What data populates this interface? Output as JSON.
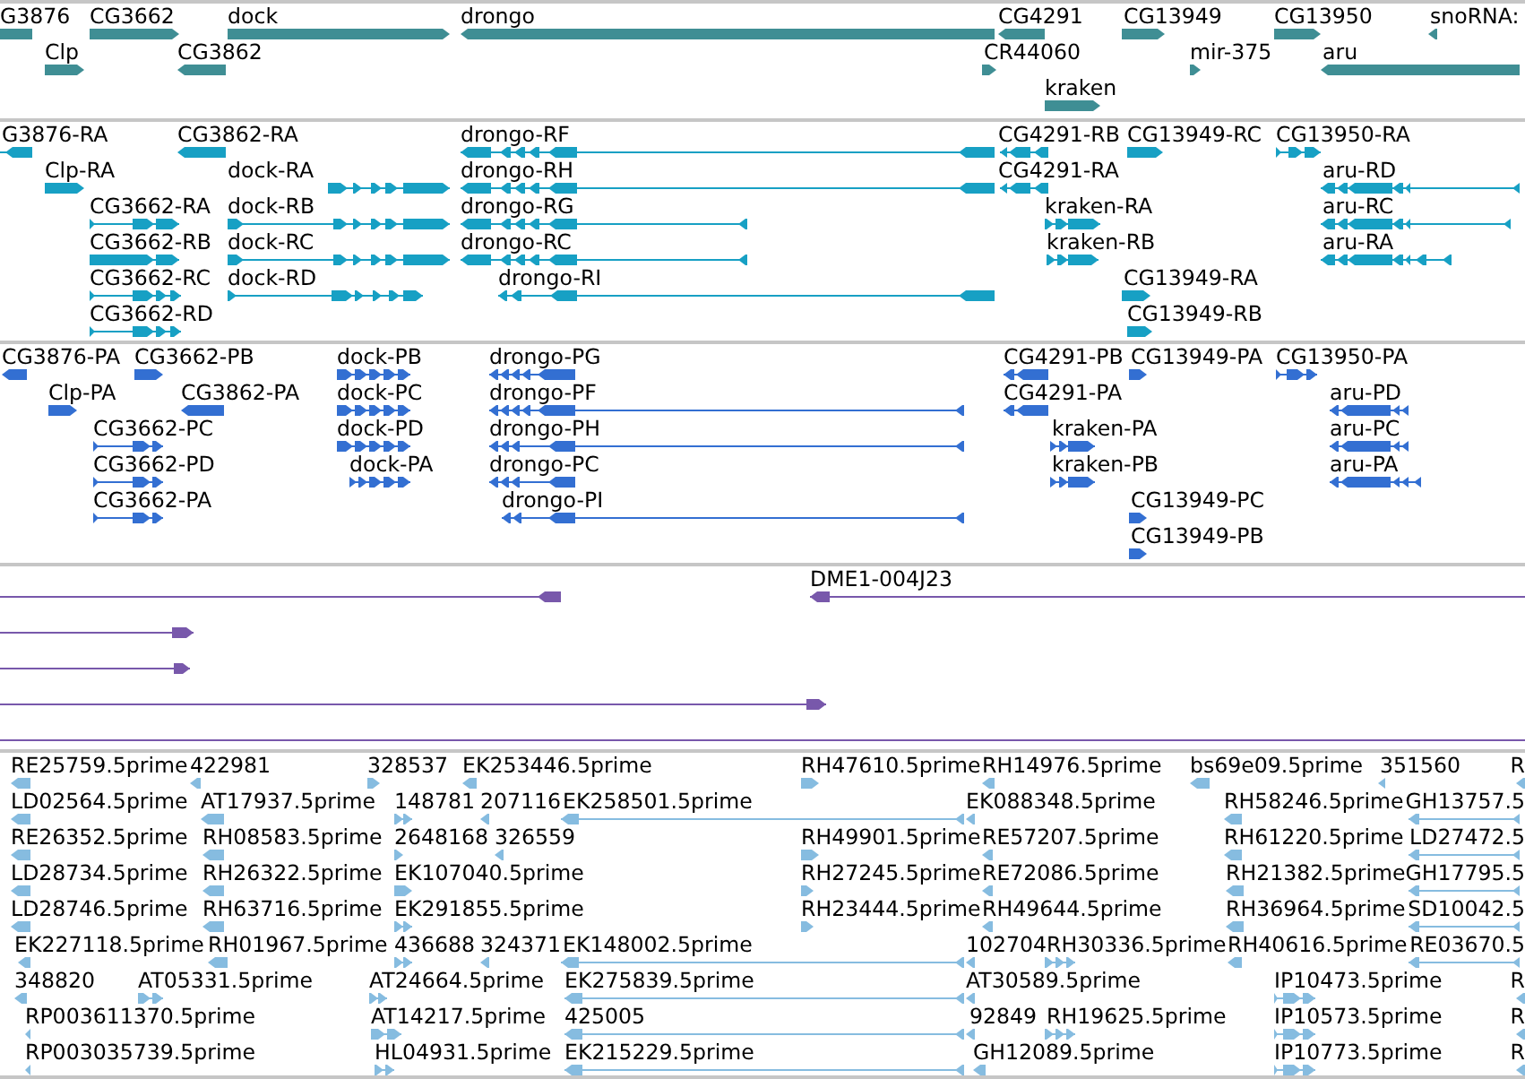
{
  "tracks": [
    {
      "color": "#3f8e94",
      "rows": [
        {
          "features": [
            {
              "label": "G3876"
            },
            {
              "label": "CG3662",
              "reverse": false
            },
            {
              "label": "dock",
              "reverse": false
            },
            {
              "label": "drongo",
              "reverse": true
            },
            {
              "label": "CG4291",
              "reverse": true
            },
            {
              "label": "CG13949",
              "reverse": false
            },
            {
              "label": "CG13950",
              "reverse": false
            },
            {
              "label": "snoRNA:",
              "reverse": true
            }
          ]
        },
        {
          "features": [
            {
              "label": "Clp",
              "reverse": false
            },
            {
              "label": "CG3862",
              "reverse": true
            },
            {
              "label": "CR44060",
              "reverse": false
            },
            {
              "label": "mir-375",
              "reverse": false
            },
            {
              "label": "aru",
              "reverse": true
            }
          ]
        },
        {
          "features": [
            {
              "label": "kraken",
              "reverse": false
            }
          ]
        }
      ]
    },
    {
      "color": "#17a0c4",
      "rows": [
        {
          "features": [
            {
              "label": "G3876-RA",
              "reverse": true
            },
            {
              "label": "CG3862-RA",
              "reverse": true
            },
            {
              "label": "drongo-RF",
              "reverse": true
            },
            {
              "label": "CG4291-RB",
              "reverse": true
            },
            {
              "label": "CG13949-RC",
              "reverse": false
            },
            {
              "label": "CG13950-RA",
              "reverse": false
            }
          ]
        },
        {
          "features": [
            {
              "label": "Clp-RA",
              "reverse": false
            },
            {
              "label": "dock-RA",
              "reverse": false
            },
            {
              "label": "drongo-RH",
              "reverse": true
            },
            {
              "label": "CG4291-RA",
              "reverse": true
            },
            {
              "label": "aru-RD",
              "reverse": true
            }
          ]
        },
        {
          "features": [
            {
              "label": "CG3662-RA",
              "reverse": false
            },
            {
              "label": "dock-RB",
              "reverse": false
            },
            {
              "label": "drongo-RG",
              "reverse": true
            },
            {
              "label": "kraken-RA",
              "reverse": false
            },
            {
              "label": "aru-RC",
              "reverse": true
            }
          ]
        },
        {
          "features": [
            {
              "label": "CG3662-RB",
              "reverse": false
            },
            {
              "label": "dock-RC",
              "reverse": false
            },
            {
              "label": "drongo-RC",
              "reverse": true
            },
            {
              "label": "kraken-RB",
              "reverse": false
            },
            {
              "label": "aru-RA",
              "reverse": true
            }
          ]
        },
        {
          "features": [
            {
              "label": "CG3662-RC",
              "reverse": false
            },
            {
              "label": "dock-RD",
              "reverse": false
            },
            {
              "label": "drongo-RI",
              "reverse": true
            },
            {
              "label": "CG13949-RA",
              "reverse": false
            }
          ]
        },
        {
          "features": [
            {
              "label": "CG3662-RD",
              "reverse": false
            },
            {
              "label": "CG13949-RB",
              "reverse": false
            }
          ]
        }
      ]
    },
    {
      "color": "#336fd2",
      "rows": [
        {
          "features": [
            {
              "label": "CG3876-PA",
              "reverse": true
            },
            {
              "label": "CG3662-PB",
              "reverse": false
            },
            {
              "label": "dock-PB",
              "reverse": false
            },
            {
              "label": "drongo-PG",
              "reverse": true
            },
            {
              "label": "CG4291-PB",
              "reverse": true
            },
            {
              "label": "CG13949-PA",
              "reverse": false
            },
            {
              "label": "CG13950-PA",
              "reverse": false
            }
          ]
        },
        {
          "features": [
            {
              "label": "Clp-PA",
              "reverse": false
            },
            {
              "label": "CG3862-PA",
              "reverse": true
            },
            {
              "label": "dock-PC",
              "reverse": false
            },
            {
              "label": "drongo-PF",
              "reverse": true
            },
            {
              "label": "CG4291-PA",
              "reverse": true
            },
            {
              "label": "aru-PD",
              "reverse": true
            }
          ]
        },
        {
          "features": [
            {
              "label": "CG3662-PC",
              "reverse": false
            },
            {
              "label": "dock-PD",
              "reverse": false
            },
            {
              "label": "drongo-PH",
              "reverse": true
            },
            {
              "label": "kraken-PA",
              "reverse": false
            },
            {
              "label": "aru-PC",
              "reverse": true
            }
          ]
        },
        {
          "features": [
            {
              "label": "CG3662-PD",
              "reverse": false
            },
            {
              "label": "dock-PA",
              "reverse": false
            },
            {
              "label": "drongo-PC",
              "reverse": true
            },
            {
              "label": "kraken-PB",
              "reverse": false
            },
            {
              "label": "aru-PA",
              "reverse": true
            }
          ]
        },
        {
          "features": [
            {
              "label": "CG3662-PA",
              "reverse": false
            },
            {
              "label": "drongo-PI",
              "reverse": true
            },
            {
              "label": "CG13949-PC",
              "reverse": false
            }
          ]
        },
        {
          "features": [
            {
              "label": "CG13949-PB",
              "reverse": false
            }
          ]
        }
      ]
    },
    {
      "color": "#7858ab",
      "rows": [
        {
          "features": [
            {
              "kind": "arrow",
              "reverse": true
            },
            {
              "kind": "arrow",
              "label": "DME1-004J23",
              "reverse": true
            }
          ]
        },
        {
          "features": [
            {
              "kind": "arrow",
              "reverse": false
            }
          ]
        },
        {
          "features": [
            {
              "kind": "arrow",
              "reverse": false
            }
          ]
        },
        {
          "features": [
            {
              "kind": "arrow",
              "reverse": false
            }
          ]
        },
        {
          "features": [
            {
              "kind": "line"
            }
          ]
        }
      ]
    },
    {
      "color": "#86bce0",
      "rows": [
        {
          "features": [
            {
              "label": "RE25759.5prime",
              "reverse": true
            },
            {
              "label": "422981",
              "reverse": true
            },
            {
              "label": "328537",
              "reverse": false
            },
            {
              "label": "EK253446.5prime",
              "reverse": true
            },
            {
              "label": "RH47610.5prime",
              "reverse": false
            },
            {
              "label": "RH14976.5prime",
              "reverse": true
            },
            {
              "label": "bs69e09.5prime",
              "reverse": true
            },
            {
              "label": "351560",
              "reverse": true
            },
            {
              "label": "R",
              "reverse": true
            }
          ]
        },
        {
          "features": [
            {
              "label": "LD02564.5prime",
              "reverse": true
            },
            {
              "label": "AT17937.5prime",
              "reverse": true
            },
            {
              "label": "148781",
              "reverse": false
            },
            {
              "label": "207116",
              "reverse": true
            },
            {
              "label": "EK258501.5prime",
              "reverse": true
            },
            {
              "label": "EK088348.5prime",
              "reverse": true
            },
            {
              "label": "RH58246.5prime",
              "reverse": true
            },
            {
              "label": "GH13757.5",
              "reverse": true
            }
          ]
        },
        {
          "features": [
            {
              "label": "RE26352.5prime",
              "reverse": true
            },
            {
              "label": "RH08583.5prime",
              "reverse": true
            },
            {
              "label": "2648168",
              "reverse": false
            },
            {
              "label": "326559",
              "reverse": true
            },
            {
              "label": "RH49901.5prime",
              "reverse": false
            },
            {
              "label": "RE57207.5prime",
              "reverse": true
            },
            {
              "label": "RH61220.5prime",
              "reverse": true
            },
            {
              "label": "LD27472.5",
              "reverse": true
            }
          ]
        },
        {
          "features": [
            {
              "label": "LD28734.5prime",
              "reverse": true
            },
            {
              "label": "RH26322.5prime",
              "reverse": true
            },
            {
              "label": "EK107040.5prime",
              "reverse": false
            },
            {
              "label": "RH27245.5prime",
              "reverse": false
            },
            {
              "label": "RE72086.5prime",
              "reverse": true
            },
            {
              "label": "RH21382.5prime",
              "reverse": true
            },
            {
              "label": "GH17795.5",
              "reverse": true
            }
          ]
        },
        {
          "features": [
            {
              "label": "LD28746.5prime",
              "reverse": true
            },
            {
              "label": "RH63716.5prime",
              "reverse": true
            },
            {
              "label": "EK291855.5prime",
              "reverse": false
            },
            {
              "label": "RH23444.5prime",
              "reverse": false
            },
            {
              "label": "RH49644.5prime",
              "reverse": true
            },
            {
              "label": "RH36964.5prime",
              "reverse": true
            },
            {
              "label": "SD10042.5",
              "reverse": true
            }
          ]
        },
        {
          "features": [
            {
              "label": "EK227118.5prime",
              "reverse": true
            },
            {
              "label": "RH01967.5prime",
              "reverse": true
            },
            {
              "label": "436688",
              "reverse": false
            },
            {
              "label": "324371",
              "reverse": true
            },
            {
              "label": "EK148002.5prime",
              "reverse": true
            },
            {
              "label": "102704",
              "reverse": true
            },
            {
              "label": "RH30336.5prime",
              "reverse": false
            },
            {
              "label": "RH40616.5prime",
              "reverse": true
            },
            {
              "label": "RE03670.5",
              "reverse": true
            }
          ]
        },
        {
          "features": [
            {
              "label": "348820",
              "reverse": true
            },
            {
              "label": "AT05331.5prime",
              "reverse": false
            },
            {
              "label": "AT24664.5prime",
              "reverse": false
            },
            {
              "label": "EK275839.5prime",
              "reverse": true
            },
            {
              "label": "AT30589.5prime",
              "reverse": true
            },
            {
              "label": "IP10473.5prime",
              "reverse": false
            },
            {
              "label": "R",
              "reverse": true
            }
          ]
        },
        {
          "features": [
            {
              "label": "RP003611370.5prime",
              "reverse": true
            },
            {
              "label": "AT14217.5prime",
              "reverse": false
            },
            {
              "label": "425005",
              "reverse": true
            },
            {
              "label": "92849",
              "reverse": true
            },
            {
              "label": "RH19625.5prime",
              "reverse": false
            },
            {
              "label": "IP10573.5prime",
              "reverse": false
            },
            {
              "label": "R",
              "reverse": true
            }
          ]
        },
        {
          "features": [
            {
              "label": "RP003035739.5prime",
              "reverse": true
            },
            {
              "label": "HL04931.5prime",
              "reverse": false
            },
            {
              "label": "EK215229.5prime",
              "reverse": true
            },
            {
              "label": "GH12089.5prime",
              "reverse": true
            },
            {
              "label": "IP10773.5prime",
              "reverse": false
            },
            {
              "label": "R",
              "reverse": true
            }
          ]
        }
      ]
    }
  ]
}
